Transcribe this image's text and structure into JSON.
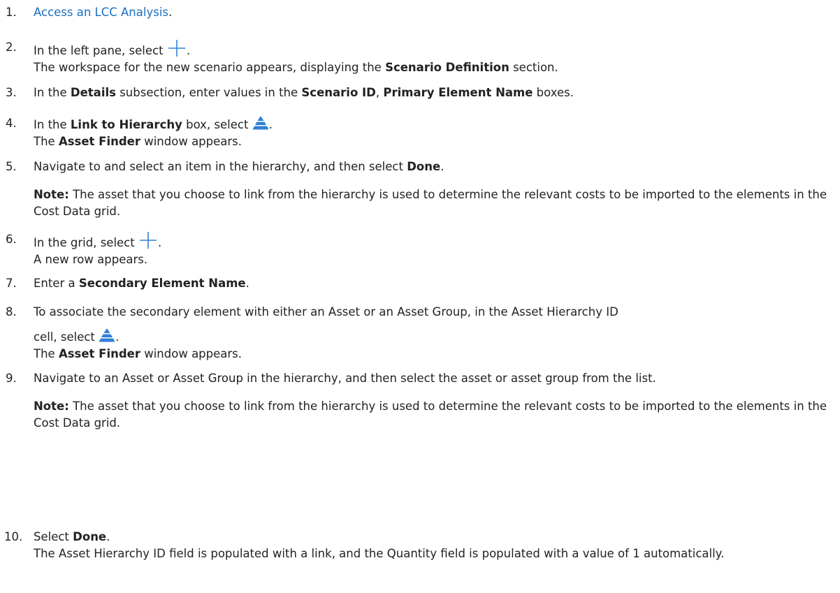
{
  "steps": [
    {
      "num": "1.",
      "link": "Access an LCC Analysis",
      "after": "."
    },
    {
      "num": "2.",
      "t1": "In the left pane, select ",
      "after": ".",
      "line2a": "The workspace for the new scenario appears, displaying the ",
      "line2b": "Scenario Definition",
      "line2c": " section."
    },
    {
      "num": "3.",
      "a": "In the ",
      "b1": "Details",
      "c": " subsection, enter values in the ",
      "b2": "Scenario ID",
      "d": ", ",
      "b3": "Primary Element Name",
      "e": " boxes."
    },
    {
      "num": "4.",
      "a": "In the ",
      "b1": "Link to Hierarchy",
      "c": " box, select ",
      "after": ".",
      "line2a": "The ",
      "line2b": "Asset Finder",
      "line2c": " window appears."
    },
    {
      "num": "5.",
      "a": "Navigate to and select an item in the hierarchy, and then select ",
      "b1": "Done",
      "after": ".",
      "note_label": "Note:",
      "note_text": " The asset that you choose to link from the hierarchy is used to determine the relevant costs to be imported to the elements in the Cost Data grid."
    },
    {
      "num": "6.",
      "t1": "In the grid, select ",
      "after": ".",
      "line2": "A new row appears."
    },
    {
      "num": "7.",
      "a": "Enter a ",
      "b1": "Secondary Element Name",
      "after": "."
    },
    {
      "num": "8.",
      "line1": "To associate the secondary element with either an Asset or an Asset Group, in the Asset Hierarchy ID",
      "line2": "cell, select ",
      "after": ".",
      "line3a": "The ",
      "line3b": "Asset Finder",
      "line3c": " window appears."
    },
    {
      "num": "9.",
      "a": "Navigate to an Asset or Asset Group in the hierarchy, and then select the asset or asset group from the list.",
      "note_label": "Note:",
      "note_text": " The asset that you choose to link from the hierarchy is used to determine the relevant costs to be imported to the elements in the Cost Data grid."
    },
    {
      "num": "10.",
      "a": "Select ",
      "b1": "Done",
      "after": ".",
      "line2": "The Asset Hierarchy ID field is populated with a link, and the Quantity field is populated with a value of 1 automatically."
    }
  ],
  "icons": {
    "add": "plus-icon",
    "hierarchy": "hierarchy-pyramid-icon"
  },
  "colors": {
    "link": "#1a6fc2",
    "icon_blue": "#2f80d6"
  }
}
